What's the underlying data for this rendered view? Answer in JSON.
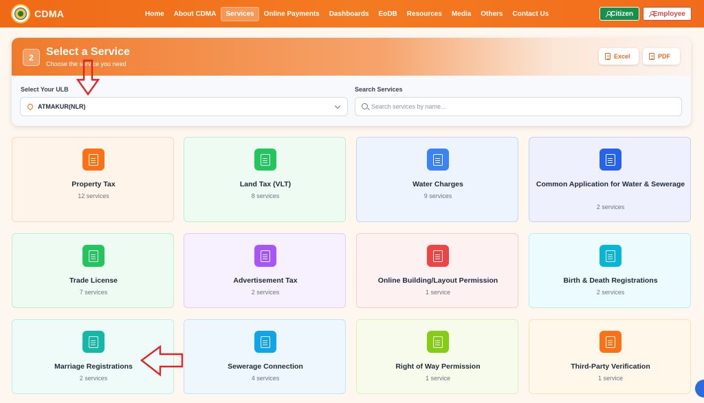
{
  "brand": {
    "name": "CDMA"
  },
  "nav": {
    "links": [
      "Home",
      "About CDMA",
      "Services",
      "Online Payments",
      "Dashboards",
      "EoDB",
      "Resources",
      "Media",
      "Others",
      "Contact Us"
    ],
    "active_index": 2,
    "citizen_label": "Citizen",
    "employee_label": "Employee"
  },
  "panel": {
    "step": "2",
    "title": "Select a Service",
    "subtitle": "Choose the service you need",
    "excel_label": "Excel",
    "pdf_label": "PDF",
    "ulb_label": "Select Your ULB",
    "ulb_value": "ATMAKUR(NLR)",
    "search_label": "Search Services",
    "search_placeholder": "Search services by name..."
  },
  "cards": [
    {
      "name": "Property Tax",
      "count": "12 services",
      "icon": "document-icon",
      "color": "#f97316",
      "bg": "#fff4ea",
      "border": "#fcd9b8"
    },
    {
      "name": "Land Tax (VLT)",
      "count": "8 services",
      "icon": "document-icon",
      "color": "#22c55e",
      "bg": "#eefbf2",
      "border": "#bfeccd"
    },
    {
      "name": "Water Charges",
      "count": "9 services",
      "icon": "document-icon",
      "color": "#3b82f6",
      "bg": "#eef4fe",
      "border": "#c3d7f6"
    },
    {
      "name": "Common Application for Water & Sewerage",
      "count": "2 services",
      "icon": "document-icon",
      "color": "#2563eb",
      "bg": "#eef1fd",
      "border": "#c6d0f4"
    },
    {
      "name": "Trade License",
      "count": "7 services",
      "icon": "document-icon",
      "color": "#22c55e",
      "bg": "#eefbf2",
      "border": "#bfeccd"
    },
    {
      "name": "Advertisement Tax",
      "count": "2 services",
      "icon": "document-icon",
      "color": "#a855f7",
      "bg": "#f7f0fe",
      "border": "#e1ccf7"
    },
    {
      "name": "Online Building/Layout Permission",
      "count": "1 service",
      "icon": "document-icon",
      "color": "#ef4444",
      "bg": "#fdf1f1",
      "border": "#f5cccc"
    },
    {
      "name": "Birth & Death Registrations",
      "count": "2 services",
      "icon": "document-icon",
      "color": "#06b6d4",
      "bg": "#ecfbfd",
      "border": "#bcecf3"
    },
    {
      "name": "Marriage Registrations",
      "count": "2 services",
      "icon": "document-icon",
      "color": "#14b8a6",
      "bg": "#eefbf8",
      "border": "#bdeee4"
    },
    {
      "name": "Sewerage Connection",
      "count": "4 services",
      "icon": "document-icon",
      "color": "#0ea5e9",
      "bg": "#edf7fd",
      "border": "#c2e2f5"
    },
    {
      "name": "Right of Way Permission",
      "count": "1 service",
      "icon": "document-icon",
      "color": "#84cc16",
      "bg": "#f6fbeb",
      "border": "#dcefba"
    },
    {
      "name": "Third-Party Verification",
      "count": "1 service",
      "icon": "document-icon",
      "color": "#f97316",
      "bg": "#fff8ea",
      "border": "#f9e2b8"
    }
  ]
}
